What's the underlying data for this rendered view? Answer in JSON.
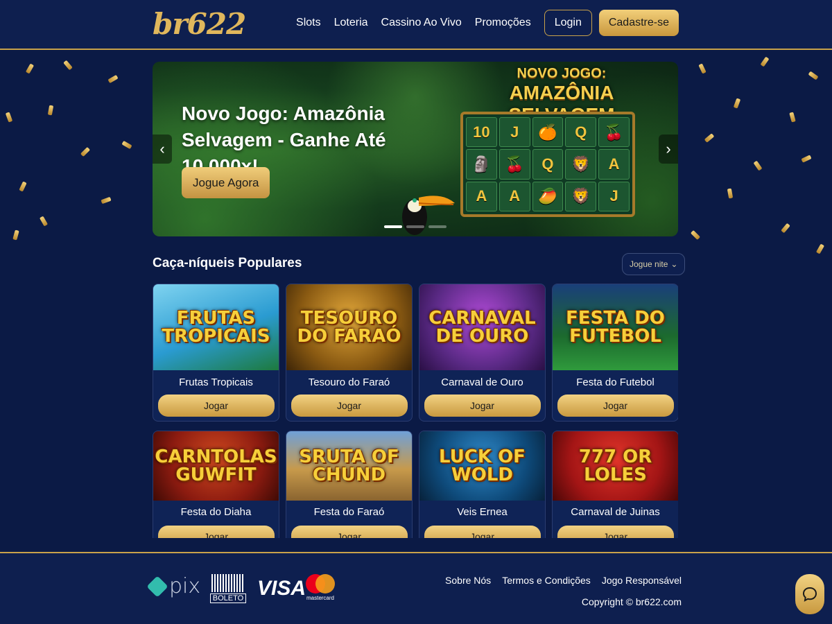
{
  "header": {
    "logo": "br622",
    "nav": [
      "Slots",
      "Loteria",
      "Cassino Ao Vivo",
      "Promoções"
    ],
    "login_label": "Login",
    "register_label": "Cadastre-se"
  },
  "banner": {
    "headline": "Novo Jogo: Amazônia Selvagem - Ganhe Até 10.000x!",
    "cta_label": "Jogue Agora",
    "art_title_line1": "NOVO JOGO:",
    "art_title_line2": "AMAZÔNIA SELVAGEM",
    "reel_symbols": [
      "10",
      "J",
      "🍊",
      "Q",
      "🍒",
      "🗿",
      "🍒",
      "Q",
      "🦁",
      "A",
      "A",
      "A",
      "🥭",
      "🦁",
      "J"
    ],
    "slides_total": 3,
    "active_slide": 1
  },
  "popular": {
    "title": "Caça-níqueis Populares",
    "filter_label": "Jogue nite",
    "games": [
      {
        "art": "FRUTAS TROPICAIS",
        "name": "Frutas Tropicais",
        "play": "Jogar",
        "bg": "#2a9bd1"
      },
      {
        "art": "TESOURO DO FARAÓ",
        "name": "Tesouro do Faraó",
        "play": "Jogar",
        "bg": "#8a5a12"
      },
      {
        "art": "CARNAVAL DE OURO",
        "name": "Carnaval de Ouro",
        "play": "Jogar",
        "bg": "#5b2a86"
      },
      {
        "art": "FESTA DO FUTEBOL",
        "name": "Festa do Futebol",
        "play": "Jogar",
        "bg": "#1c6a2e"
      },
      {
        "art": "CARNTOLAS GUWFIT",
        "name": "Festa do Diaha",
        "play": "Jogar",
        "bg": "#8c1b10"
      },
      {
        "art": "SRUTA OF CHUND",
        "name": "Festa do Faraó",
        "play": "Jogar",
        "bg": "#c79a4b"
      },
      {
        "art": "LUCK OF WOLD",
        "name": "Veis Ernea",
        "play": "Jogar",
        "bg": "#0e4a7a"
      },
      {
        "art": "777 OR LOLES",
        "name": "Carnaval de Juinas",
        "play": "Jogar",
        "bg": "#a31515"
      }
    ]
  },
  "footer": {
    "payments": {
      "pix": "pix",
      "boleto": "BOLETO",
      "visa": "VISA",
      "mastercard": "mastercard"
    },
    "links": [
      "Sobre Nós",
      "Termos e Condições",
      "Jogo Responsável"
    ],
    "copyright": "Copyright © br622.com"
  },
  "colors": {
    "gold": "#c9a24a",
    "navy": "#0b1a45",
    "button_gold": "#e6bd66"
  },
  "icons": {
    "prev": "chevron-left-icon",
    "next": "chevron-right-icon",
    "chat": "chat-bubble-icon"
  }
}
